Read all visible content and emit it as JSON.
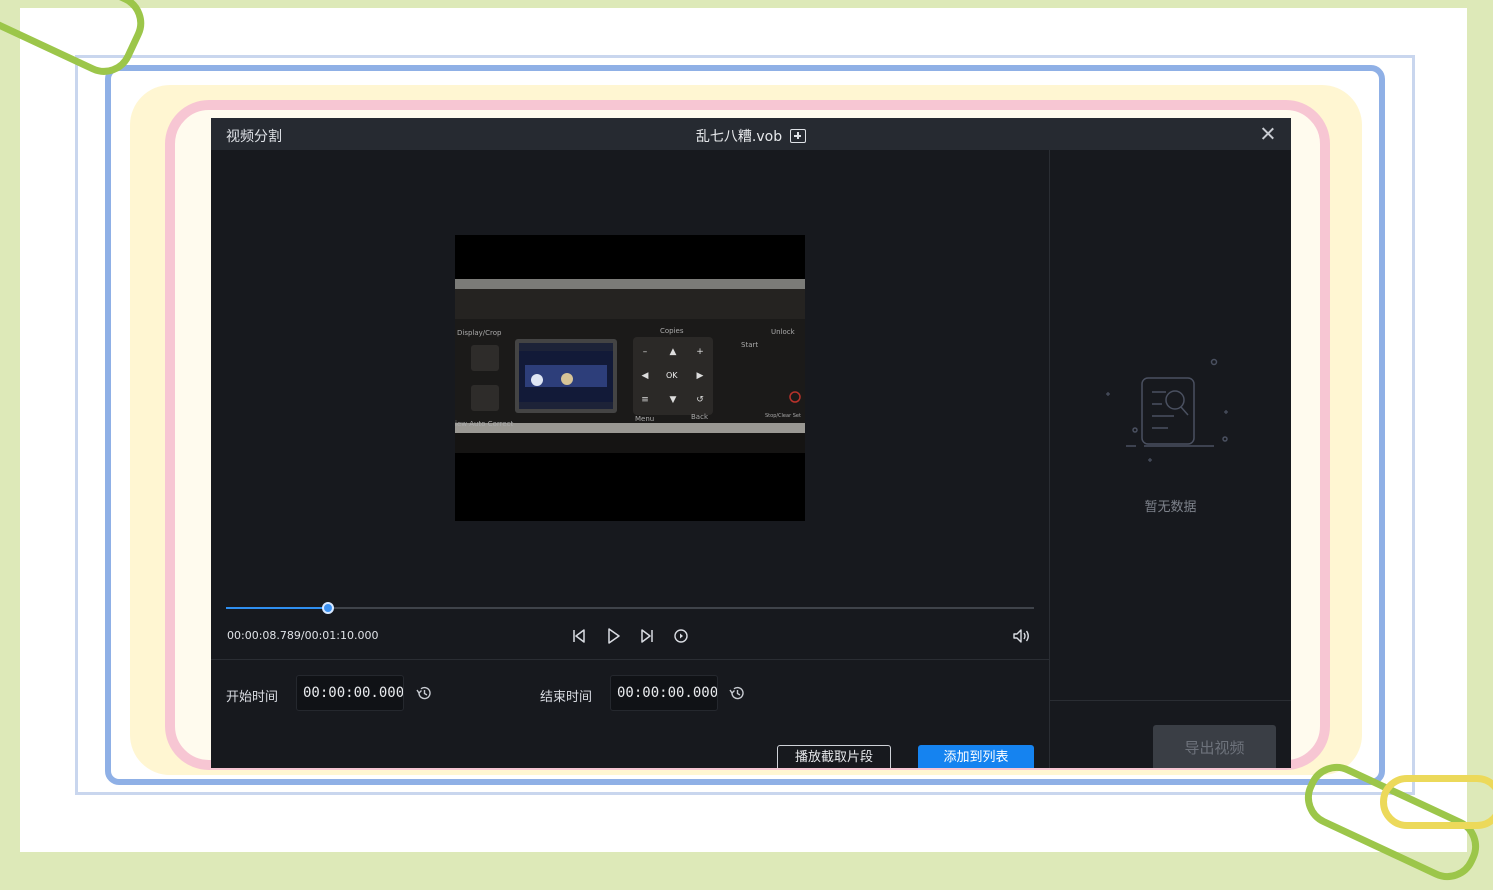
{
  "dialog": {
    "title": "视频分割",
    "file_name": "乱七八糟.vob",
    "add_file_icon": "add-file-icon",
    "close_icon": "close-icon"
  },
  "player": {
    "timecode": "00:00:08.789/00:01:10.000",
    "progress": 0.126,
    "controls": [
      "skip-back-icon",
      "play-icon",
      "skip-forward-icon",
      "loop-icon",
      "volume-icon"
    ]
  },
  "video_frame_text": {
    "display_crop": "Display/Crop",
    "copies": "Copies",
    "unlock": "Unlock",
    "start": "Start",
    "ok": "OK",
    "menu": "Menu",
    "back": "Back",
    "stop_clear": "Stop/Clear Set",
    "auto_correct": "iew Auto Correct"
  },
  "trim": {
    "start_label": "开始时间",
    "start_value": "00:00:00.000",
    "end_label": "结束时间",
    "end_value": "00:00:00.000"
  },
  "buttons": {
    "play_clip": "播放截取片段",
    "add_to_list": "添加到列表",
    "export": "导出视频"
  },
  "right_panel": {
    "empty_text": "暂无数据"
  },
  "colors": {
    "accent": "#1583f0",
    "dialog_bg": "#17191e",
    "titlebar_bg": "#262a31"
  }
}
